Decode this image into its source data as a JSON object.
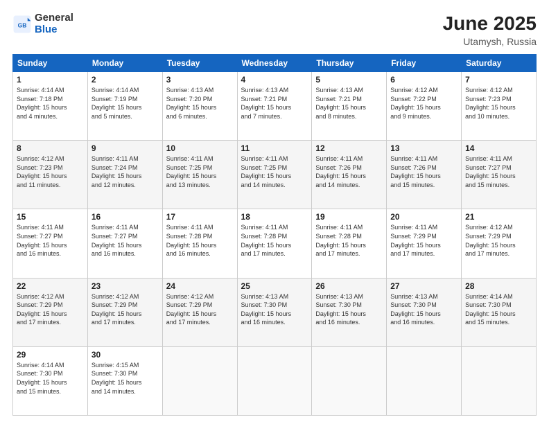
{
  "header": {
    "logo_general": "General",
    "logo_blue": "Blue",
    "title": "June 2025",
    "location": "Utamysh, Russia"
  },
  "weekdays": [
    "Sunday",
    "Monday",
    "Tuesday",
    "Wednesday",
    "Thursday",
    "Friday",
    "Saturday"
  ],
  "weeks": [
    [
      {
        "day": "1",
        "info": "Sunrise: 4:14 AM\nSunset: 7:18 PM\nDaylight: 15 hours\nand 4 minutes."
      },
      {
        "day": "2",
        "info": "Sunrise: 4:14 AM\nSunset: 7:19 PM\nDaylight: 15 hours\nand 5 minutes."
      },
      {
        "day": "3",
        "info": "Sunrise: 4:13 AM\nSunset: 7:20 PM\nDaylight: 15 hours\nand 6 minutes."
      },
      {
        "day": "4",
        "info": "Sunrise: 4:13 AM\nSunset: 7:21 PM\nDaylight: 15 hours\nand 7 minutes."
      },
      {
        "day": "5",
        "info": "Sunrise: 4:13 AM\nSunset: 7:21 PM\nDaylight: 15 hours\nand 8 minutes."
      },
      {
        "day": "6",
        "info": "Sunrise: 4:12 AM\nSunset: 7:22 PM\nDaylight: 15 hours\nand 9 minutes."
      },
      {
        "day": "7",
        "info": "Sunrise: 4:12 AM\nSunset: 7:23 PM\nDaylight: 15 hours\nand 10 minutes."
      }
    ],
    [
      {
        "day": "8",
        "info": "Sunrise: 4:12 AM\nSunset: 7:23 PM\nDaylight: 15 hours\nand 11 minutes."
      },
      {
        "day": "9",
        "info": "Sunrise: 4:11 AM\nSunset: 7:24 PM\nDaylight: 15 hours\nand 12 minutes."
      },
      {
        "day": "10",
        "info": "Sunrise: 4:11 AM\nSunset: 7:25 PM\nDaylight: 15 hours\nand 13 minutes."
      },
      {
        "day": "11",
        "info": "Sunrise: 4:11 AM\nSunset: 7:25 PM\nDaylight: 15 hours\nand 14 minutes."
      },
      {
        "day": "12",
        "info": "Sunrise: 4:11 AM\nSunset: 7:26 PM\nDaylight: 15 hours\nand 14 minutes."
      },
      {
        "day": "13",
        "info": "Sunrise: 4:11 AM\nSunset: 7:26 PM\nDaylight: 15 hours\nand 15 minutes."
      },
      {
        "day": "14",
        "info": "Sunrise: 4:11 AM\nSunset: 7:27 PM\nDaylight: 15 hours\nand 15 minutes."
      }
    ],
    [
      {
        "day": "15",
        "info": "Sunrise: 4:11 AM\nSunset: 7:27 PM\nDaylight: 15 hours\nand 16 minutes."
      },
      {
        "day": "16",
        "info": "Sunrise: 4:11 AM\nSunset: 7:27 PM\nDaylight: 15 hours\nand 16 minutes."
      },
      {
        "day": "17",
        "info": "Sunrise: 4:11 AM\nSunset: 7:28 PM\nDaylight: 15 hours\nand 16 minutes."
      },
      {
        "day": "18",
        "info": "Sunrise: 4:11 AM\nSunset: 7:28 PM\nDaylight: 15 hours\nand 17 minutes."
      },
      {
        "day": "19",
        "info": "Sunrise: 4:11 AM\nSunset: 7:28 PM\nDaylight: 15 hours\nand 17 minutes."
      },
      {
        "day": "20",
        "info": "Sunrise: 4:11 AM\nSunset: 7:29 PM\nDaylight: 15 hours\nand 17 minutes."
      },
      {
        "day": "21",
        "info": "Sunrise: 4:12 AM\nSunset: 7:29 PM\nDaylight: 15 hours\nand 17 minutes."
      }
    ],
    [
      {
        "day": "22",
        "info": "Sunrise: 4:12 AM\nSunset: 7:29 PM\nDaylight: 15 hours\nand 17 minutes."
      },
      {
        "day": "23",
        "info": "Sunrise: 4:12 AM\nSunset: 7:29 PM\nDaylight: 15 hours\nand 17 minutes."
      },
      {
        "day": "24",
        "info": "Sunrise: 4:12 AM\nSunset: 7:29 PM\nDaylight: 15 hours\nand 17 minutes."
      },
      {
        "day": "25",
        "info": "Sunrise: 4:13 AM\nSunset: 7:30 PM\nDaylight: 15 hours\nand 16 minutes."
      },
      {
        "day": "26",
        "info": "Sunrise: 4:13 AM\nSunset: 7:30 PM\nDaylight: 15 hours\nand 16 minutes."
      },
      {
        "day": "27",
        "info": "Sunrise: 4:13 AM\nSunset: 7:30 PM\nDaylight: 15 hours\nand 16 minutes."
      },
      {
        "day": "28",
        "info": "Sunrise: 4:14 AM\nSunset: 7:30 PM\nDaylight: 15 hours\nand 15 minutes."
      }
    ],
    [
      {
        "day": "29",
        "info": "Sunrise: 4:14 AM\nSunset: 7:30 PM\nDaylight: 15 hours\nand 15 minutes."
      },
      {
        "day": "30",
        "info": "Sunrise: 4:15 AM\nSunset: 7:30 PM\nDaylight: 15 hours\nand 14 minutes."
      },
      {
        "day": "",
        "info": ""
      },
      {
        "day": "",
        "info": ""
      },
      {
        "day": "",
        "info": ""
      },
      {
        "day": "",
        "info": ""
      },
      {
        "day": "",
        "info": ""
      }
    ]
  ]
}
